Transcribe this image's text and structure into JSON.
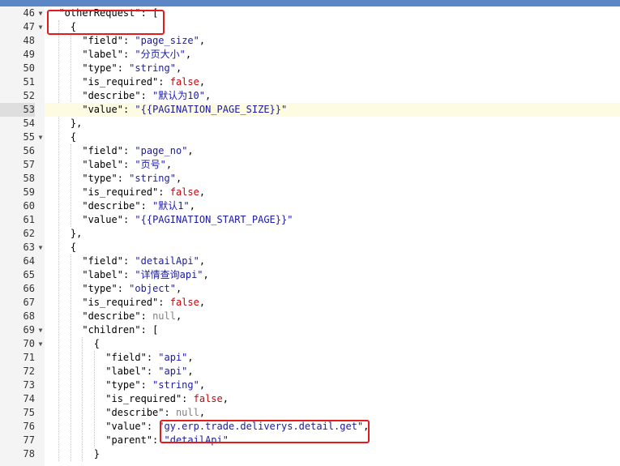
{
  "lines": [
    {
      "num": "46",
      "fold": true,
      "indent": 2,
      "text": "\"otherRequest\": ["
    },
    {
      "num": "47",
      "fold": true,
      "indent": 4,
      "text": "{"
    },
    {
      "num": "48",
      "fold": false,
      "indent": 6,
      "text": "\"field\": \"page_size\","
    },
    {
      "num": "49",
      "fold": false,
      "indent": 6,
      "text": "\"label\": \"分页大小\","
    },
    {
      "num": "50",
      "fold": false,
      "indent": 6,
      "text": "\"type\": \"string\","
    },
    {
      "num": "51",
      "fold": false,
      "indent": 6,
      "text": "\"is_required\": false,"
    },
    {
      "num": "52",
      "fold": false,
      "indent": 6,
      "text": "\"describe\": \"默认为10\","
    },
    {
      "num": "53",
      "fold": false,
      "indent": 6,
      "text": "\"value\": \"{{PAGINATION_PAGE_SIZE}}\"",
      "active": true
    },
    {
      "num": "54",
      "fold": false,
      "indent": 4,
      "text": "},"
    },
    {
      "num": "55",
      "fold": true,
      "indent": 4,
      "text": "{"
    },
    {
      "num": "56",
      "fold": false,
      "indent": 6,
      "text": "\"field\": \"page_no\","
    },
    {
      "num": "57",
      "fold": false,
      "indent": 6,
      "text": "\"label\": \"页号\","
    },
    {
      "num": "58",
      "fold": false,
      "indent": 6,
      "text": "\"type\": \"string\","
    },
    {
      "num": "59",
      "fold": false,
      "indent": 6,
      "text": "\"is_required\": false,"
    },
    {
      "num": "60",
      "fold": false,
      "indent": 6,
      "text": "\"describe\": \"默认1\","
    },
    {
      "num": "61",
      "fold": false,
      "indent": 6,
      "text": "\"value\": \"{{PAGINATION_START_PAGE}}\""
    },
    {
      "num": "62",
      "fold": false,
      "indent": 4,
      "text": "},"
    },
    {
      "num": "63",
      "fold": true,
      "indent": 4,
      "text": "{"
    },
    {
      "num": "64",
      "fold": false,
      "indent": 6,
      "text": "\"field\": \"detailApi\","
    },
    {
      "num": "65",
      "fold": false,
      "indent": 6,
      "text": "\"label\": \"详情查询api\","
    },
    {
      "num": "66",
      "fold": false,
      "indent": 6,
      "text": "\"type\": \"object\","
    },
    {
      "num": "67",
      "fold": false,
      "indent": 6,
      "text": "\"is_required\": false,"
    },
    {
      "num": "68",
      "fold": false,
      "indent": 6,
      "text": "\"describe\": null,"
    },
    {
      "num": "69",
      "fold": true,
      "indent": 6,
      "text": "\"children\": ["
    },
    {
      "num": "70",
      "fold": true,
      "indent": 8,
      "text": "{"
    },
    {
      "num": "71",
      "fold": false,
      "indent": 10,
      "text": "\"field\": \"api\","
    },
    {
      "num": "72",
      "fold": false,
      "indent": 10,
      "text": "\"label\": \"api\","
    },
    {
      "num": "73",
      "fold": false,
      "indent": 10,
      "text": "\"type\": \"string\","
    },
    {
      "num": "74",
      "fold": false,
      "indent": 10,
      "text": "\"is_required\": false,"
    },
    {
      "num": "75",
      "fold": false,
      "indent": 10,
      "text": "\"describe\": null,"
    },
    {
      "num": "76",
      "fold": false,
      "indent": 10,
      "text": "\"value\": \"gy.erp.trade.deliverys.detail.get\","
    },
    {
      "num": "77",
      "fold": false,
      "indent": 10,
      "text": "\"parent\": \"detailApi\""
    },
    {
      "num": "78",
      "fold": false,
      "indent": 8,
      "text": "}"
    }
  ],
  "colors": {
    "string": "#1a1aa6",
    "boolean": "#c5060b",
    "null": "#808080",
    "highlight_box": "#e31b1b",
    "active_line": "#fdfbe1",
    "gutter": "#f4f4f4"
  }
}
